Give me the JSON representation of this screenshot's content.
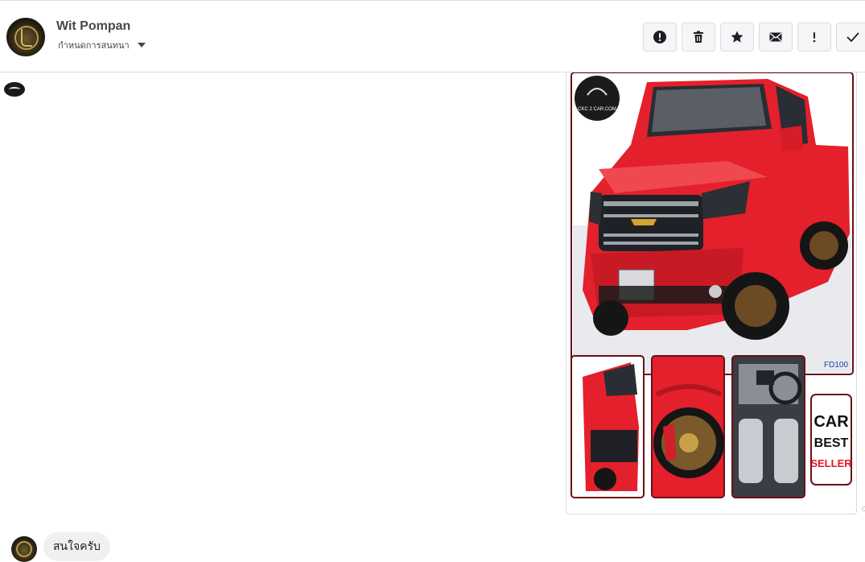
{
  "header": {
    "contact_name": "Wit Pompan",
    "conversation_menu_label": "กำหนดการสนทนา"
  },
  "actions": [
    {
      "name": "mark-spam-button",
      "icon": "alert-circle-icon"
    },
    {
      "name": "delete-button",
      "icon": "trash-icon"
    },
    {
      "name": "star-button",
      "icon": "star-icon"
    },
    {
      "name": "mark-unread-button",
      "icon": "envelope-icon"
    },
    {
      "name": "mark-important-button",
      "icon": "exclamation-icon"
    },
    {
      "name": "mark-done-button",
      "icon": "check-icon"
    }
  ],
  "attachment": {
    "logo_text": "CKC 2 CAR.COM",
    "stock_code": "FD100",
    "badge": {
      "line1": "CAR",
      "line2": "BEST",
      "line3": "SELLER"
    }
  },
  "message": {
    "text": "สนใจครับ"
  },
  "colors": {
    "icon": "#1c1e21",
    "car_red": "#e3202c",
    "seller_red": "#e01b24"
  }
}
